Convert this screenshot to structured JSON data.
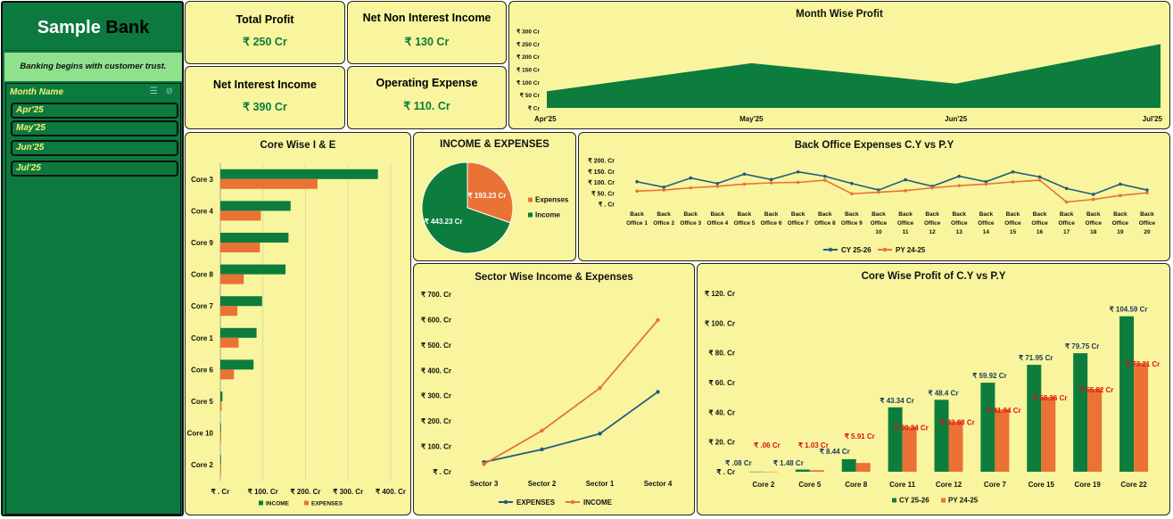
{
  "sidebar": {
    "brand_part1": "Sample",
    "brand_part2": "Bank",
    "tagline": "Banking begins with customer trust.",
    "slicer_title": "Month Name",
    "slicer_icons": [
      "multi-select-icon",
      "clear-filter-icon"
    ],
    "months": [
      "Apr'25",
      "May'25",
      "Jun'25",
      "Jul'25"
    ]
  },
  "kpis": {
    "total_profit": {
      "label": "Total Profit",
      "value": "₹ 250 Cr"
    },
    "net_non_interest_income": {
      "label": "Net Non Interest Income",
      "value": "₹ 130 Cr"
    },
    "net_interest_income": {
      "label": "Net Interest Income",
      "value": "₹ 390 Cr"
    },
    "operating_expense": {
      "label": "Operating Expense",
      "value": "₹ 110. Cr"
    }
  },
  "colors": {
    "green": "#0c7d3d",
    "orange": "#ea7235",
    "navy": "#1f5c7d",
    "panel": "#f8f59e",
    "label_red": "#e01010"
  },
  "chart_data": [
    {
      "id": "month_profit",
      "type": "area",
      "title": "Month Wise Profit",
      "categories": [
        "Apr'25",
        "May'25",
        "Jun'25",
        "Jul'25"
      ],
      "values": [
        65,
        175,
        95,
        250
      ],
      "yticks": [
        "₹ Cr",
        "₹ 50 Cr",
        "₹ 100 Cr",
        "₹ 150 Cr",
        "₹ 200 Cr",
        "₹ 250 Cr",
        "₹ 300 Cr"
      ],
      "ylim": [
        0,
        300
      ]
    },
    {
      "id": "core_ie",
      "type": "bar",
      "orientation": "horizontal",
      "title": "Core Wise I & E",
      "categories": [
        "Core 3",
        "Core 4",
        "Core 9",
        "Core 8",
        "Core 7",
        "Core 1",
        "Core 6",
        "Core 5",
        "Core 10",
        "Core 2"
      ],
      "series": [
        {
          "name": "INCOME",
          "values": [
            370,
            165,
            160,
            153,
            98,
            85,
            78,
            5,
            1,
            1
          ]
        },
        {
          "name": "EXPENSES",
          "values": [
            228,
            95,
            93,
            55,
            40,
            43,
            32,
            3,
            1,
            1
          ]
        }
      ],
      "xticks": [
        "₹ . Cr",
        "₹ 100. Cr",
        "₹ 200. Cr",
        "₹ 300. Cr",
        "₹ 400. Cr"
      ],
      "xlim": [
        0,
        400
      ],
      "grid": true,
      "legend": "bottom"
    },
    {
      "id": "income_expenses",
      "type": "pie",
      "title": "INCOME & EXPENSES",
      "slices": [
        {
          "name": "Expenses",
          "value": 193.23,
          "label": "₹ 193.23 Cr"
        },
        {
          "name": "Income",
          "value": 443.23,
          "label": "₹ 443.23 Cr"
        }
      ],
      "legend": "right"
    },
    {
      "id": "back_office",
      "type": "line",
      "title": "Back Office Expenses C.Y vs P.Y",
      "categories": [
        "Back Office 1",
        "Back Office 2",
        "Back Office 3",
        "Back Office 4",
        "Back Office 5",
        "Back Office 6",
        "Back Office 7",
        "Back Office 8",
        "Back Office 9",
        "Back Office 10",
        "Back Office 11",
        "Back Office 12",
        "Back Office 13",
        "Back Office 14",
        "Back Office 15",
        "Back Office 16",
        "Back Office 17",
        "Back Office 18",
        "Back Office 19",
        "Back Office 20"
      ],
      "series": [
        {
          "name": "CY 25-26",
          "values": [
            103,
            78,
            120,
            95,
            138,
            113,
            148,
            128,
            95,
            65,
            112,
            82,
            128,
            103,
            148,
            125,
            72,
            45,
            92,
            65
          ]
        },
        {
          "name": "PY 24-25",
          "values": [
            60,
            65,
            75,
            82,
            92,
            98,
            100,
            110,
            48,
            55,
            62,
            75,
            85,
            92,
            102,
            110,
            10,
            22,
            40,
            52
          ]
        }
      ],
      "yticks": [
        "₹ . Cr",
        "₹ 50. Cr",
        "₹ 100. Cr",
        "₹ 150. Cr",
        "₹ 200. Cr"
      ],
      "ylim": [
        0,
        200
      ],
      "legend": "bottom"
    },
    {
      "id": "sector_ie",
      "type": "line",
      "title": "Sector Wise Income & Expenses",
      "categories": [
        "Sector 3",
        "Sector 2",
        "Sector 1",
        "Sector 4"
      ],
      "series": [
        {
          "name": "EXPENSES",
          "values": [
            38,
            88,
            150,
            315
          ]
        },
        {
          "name": "INCOME",
          "values": [
            30,
            162,
            330,
            598
          ]
        }
      ],
      "yticks": [
        "₹ . Cr",
        "₹ 100. Cr",
        "₹ 200. Cr",
        "₹ 300. Cr",
        "₹ 400. Cr",
        "₹ 500. Cr",
        "₹ 600. Cr",
        "₹ 700. Cr"
      ],
      "ylim": [
        0,
        700
      ],
      "legend": "bottom"
    },
    {
      "id": "core_profit",
      "type": "bar",
      "title": "Core Wise Profit of C.Y vs P.Y",
      "categories": [
        "Core 2",
        "Core 5",
        "Core 8",
        "Core 11",
        "Core 12",
        "Core 7",
        "Core 15",
        "Core 19",
        "Core 22"
      ],
      "series": [
        {
          "name": "CY 25-26",
          "values": [
            0.08,
            1.48,
            8.44,
            43.34,
            48.4,
            59.92,
            71.95,
            79.75,
            104.59
          ],
          "labels": [
            "₹ .08 Cr",
            "₹ 1.48 Cr",
            "₹ 8.44 Cr",
            "₹ 43.34 Cr",
            "₹ 48.4 Cr",
            "₹ 59.92 Cr",
            "₹ 71.95 Cr",
            "₹ 79.75 Cr",
            "₹ 104.59 Cr"
          ]
        },
        {
          "name": "PY 24-25",
          "values": [
            0.06,
            1.03,
            5.91,
            30.34,
            33.88,
            41.94,
            50.36,
            55.82,
            73.21
          ],
          "labels": [
            "₹ .06 Cr",
            "₹ 1.03 Cr",
            "₹ 5.91 Cr",
            "₹ 30.34 Cr",
            "₹ 33.88 Cr",
            "₹ 41.94 Cr",
            "₹ 50.36 Cr",
            "₹ 55.82 Cr",
            "₹ 73.21 Cr"
          ]
        }
      ],
      "yticks": [
        "₹ . Cr",
        "₹ 20. Cr",
        "₹ 40. Cr",
        "₹ 60. Cr",
        "₹ 80. Cr",
        "₹ 100. Cr",
        "₹ 120. Cr"
      ],
      "ylim": [
        0,
        120
      ],
      "legend": "bottom"
    }
  ]
}
